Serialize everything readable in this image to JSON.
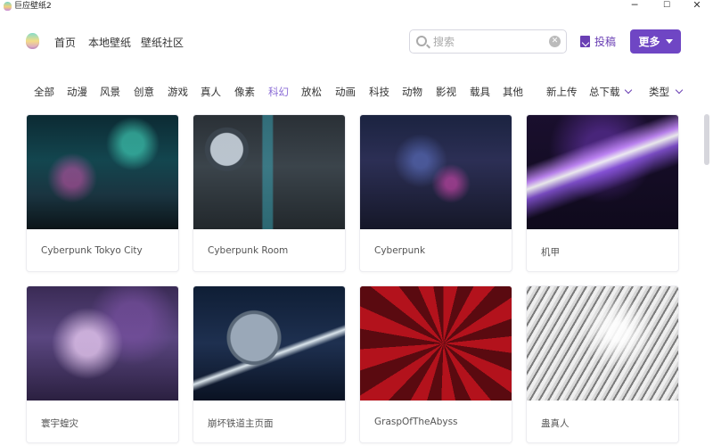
{
  "window": {
    "title": "巨应壁纸2",
    "minimize": "─",
    "maximize": "☐",
    "close": "✕"
  },
  "header": {
    "nav": [
      "首页",
      "本地壁纸",
      "壁纸社区"
    ],
    "search_placeholder": "搜索",
    "contribute_label": "投稿",
    "more_label": "更多"
  },
  "categories": [
    "全部",
    "动漫",
    "风景",
    "创意",
    "游戏",
    "真人",
    "像素",
    "科幻",
    "放松",
    "动画",
    "科技",
    "动物",
    "影视",
    "载具",
    "其他"
  ],
  "active_category": "科幻",
  "sorters": {
    "newest": "新上传",
    "downloads": "总下载",
    "type": "类型"
  },
  "wallpapers": [
    {
      "title": "Cyberpunk Tokyo City"
    },
    {
      "title": "Cyberpunk Room"
    },
    {
      "title": "Cyberpunk"
    },
    {
      "title": "机甲"
    },
    {
      "title": "寰宇蝗灾"
    },
    {
      "title": "崩坏铁道主页面"
    },
    {
      "title": "GraspOfTheAbyss"
    },
    {
      "title": "蛊真人"
    }
  ],
  "colors": {
    "accent": "#6f46c4",
    "active_category": "#8a6bd6"
  }
}
